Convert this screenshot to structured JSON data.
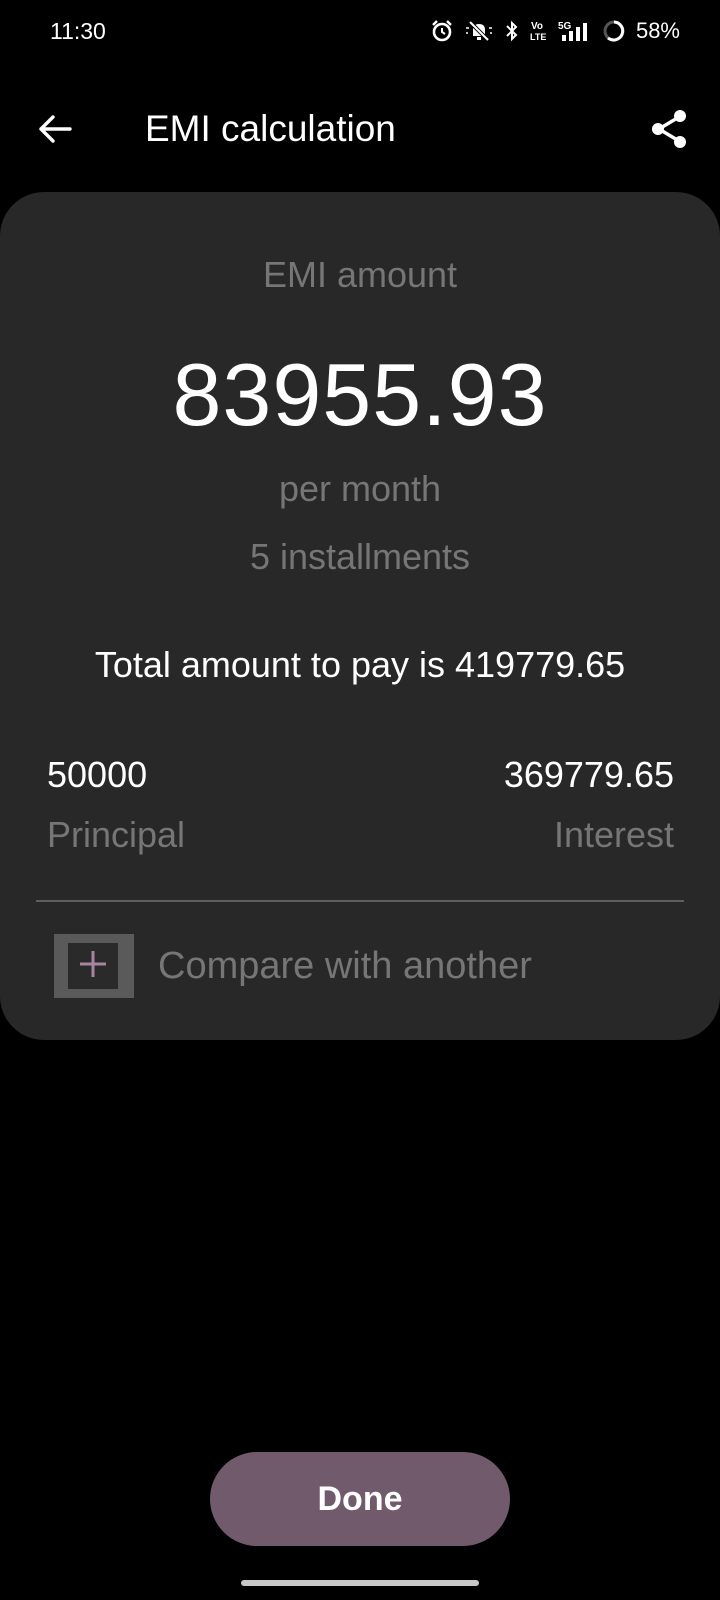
{
  "status_bar": {
    "time": "11:30",
    "icons": [
      "alarm-icon",
      "mute-icon",
      "bluetooth-icon",
      "volte-icon",
      "5g-signal-icon",
      "battery-ring-icon"
    ],
    "battery_percent": "58%"
  },
  "app_bar": {
    "title": "EMI calculation",
    "back_icon": "arrow-left-icon",
    "share_icon": "share-icon"
  },
  "result": {
    "emi_label": "EMI amount",
    "emi_value": "83955.93",
    "per_month": "per month",
    "installments": "5 installments",
    "total_text": "Total amount to pay is 419779.65",
    "principal_value": "50000",
    "principal_label": "Principal",
    "interest_value": "369779.65",
    "interest_label": "Interest",
    "compare_label": "Compare with another"
  },
  "actions": {
    "done_label": "Done"
  },
  "colors": {
    "accent": "#725a6d",
    "plus": "#a8849f",
    "card": "#282828"
  }
}
